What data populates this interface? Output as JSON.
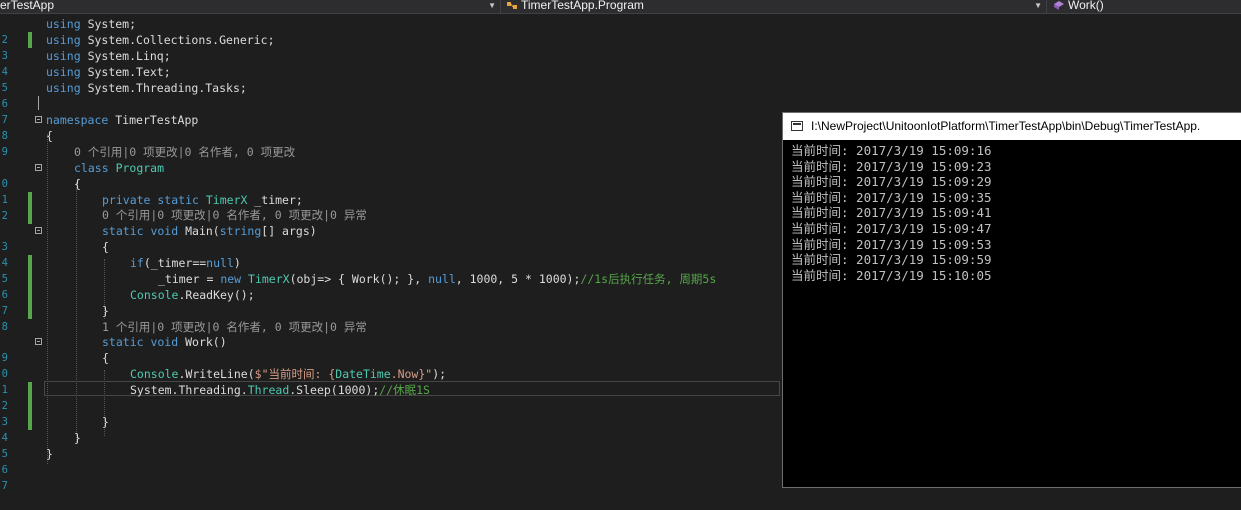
{
  "nav": {
    "project": "erTestApp",
    "class": "TimerTestApp.Program",
    "member": "Work()"
  },
  "editor": {
    "line_numbers": [
      "2",
      "3",
      "4",
      "5",
      "6",
      "7",
      "8",
      "9",
      "",
      "0",
      "1",
      "2",
      "",
      "3",
      "4",
      "5",
      "6",
      "7",
      "8",
      "",
      "9",
      "0",
      "1",
      "2",
      "3",
      "4",
      "5",
      "6",
      "7"
    ],
    "lens": {
      "class": "0 个引用|0 项更改|0 名作者, 0 项更改",
      "main": "0 个引用|0 项更改|0 名作者, 0 项更改|0 异常",
      "work": "1 个引用|0 项更改|0 名作者, 0 项更改|0 异常"
    },
    "code": {
      "u1": "System;",
      "u2": "System.Collections.Generic;",
      "u3": "System.Linq;",
      "u4": "System.Text;",
      "u5": "System.Threading.Tasks;",
      "using_kw": "using",
      "ns_kw": "namespace",
      "ns_name": "TimerTestApp",
      "class_kw": "class",
      "class_name": "Program",
      "field_kw": "private static",
      "field_type": "TimerX",
      "field_name": "_timer;",
      "main_kw": "static void",
      "main_name": "Main(",
      "main_param_kw": "string",
      "main_param": "[] args)",
      "if_kw": "if",
      "if_cond_a": "(_timer==",
      "if_null": "null",
      "if_cond_b": ")",
      "assign_a": "_timer = ",
      "new_kw": "new",
      "assign_type": "TimerX",
      "assign_b": "(obj=> { Work(); }, ",
      "assign_null": "null",
      "assign_c": ", 1000, 5 * 1000);",
      "assign_comment": "//1s后执行任务, 周期5s",
      "readkey_type": "Console",
      "readkey_rest": ".ReadKey();",
      "work_kw": "static void",
      "work_name": "Work()",
      "wl_type": "Console",
      "wl_a": ".WriteLine(",
      "wl_str_a": "$\"当前时间: {",
      "wl_type2": "DateTime",
      "wl_b": ".Now}\"",
      "wl_c": ");",
      "sleep_a": "System.Threading.",
      "sleep_type": "Thread",
      "sleep_b": ".Sleep(1000);",
      "sleep_comment": "//休眠1S",
      "open": "{",
      "close": "}"
    }
  },
  "console": {
    "title": "I:\\NewProject\\UnitoonIotPlatform\\TimerTestApp\\bin\\Debug\\TimerTestApp.",
    "lines": [
      "当前时间: 2017/3/19 15:09:16",
      "当前时间: 2017/3/19 15:09:23",
      "当前时间: 2017/3/19 15:09:29",
      "当前时间: 2017/3/19 15:09:35",
      "当前时间: 2017/3/19 15:09:41",
      "当前时间: 2017/3/19 15:09:47",
      "当前时间: 2017/3/19 15:09:53",
      "当前时间: 2017/3/19 15:09:59",
      "当前时间: 2017/3/19 15:10:05"
    ]
  },
  "colors": {
    "editor_bg": "#1e1e1e",
    "keyword": "#569cd6",
    "type": "#4ec9b0",
    "string": "#d69d85",
    "comment": "#57a64a",
    "line_number": "#2b91af",
    "console_bg": "#000000",
    "console_text": "#c0c0c0"
  }
}
